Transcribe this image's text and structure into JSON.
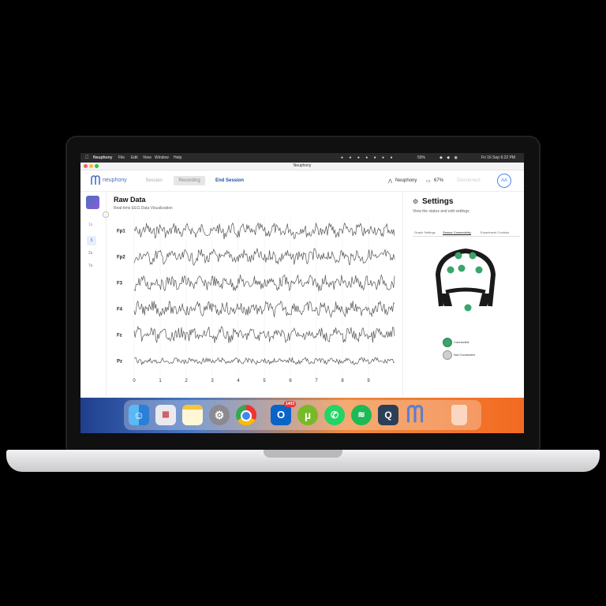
{
  "menubar": {
    "app": "Neuphony",
    "items": [
      "File",
      "Edit",
      "View",
      "Window",
      "Help"
    ],
    "battery": "59%",
    "datetime": "Fri 16 Sep 6:22 PM"
  },
  "window": {
    "title": "Neuphony"
  },
  "header": {
    "logo_text": "neuphony",
    "nav": [
      "Session",
      "Recording",
      "End Session"
    ],
    "device_name": "Neuphony",
    "battery": "67%",
    "status_btn": "Disconnect",
    "avatar": "AA"
  },
  "eeg": {
    "title": "Raw Data",
    "subtitle": "Real-time EEG Data Visualization",
    "channels": [
      "Fp1",
      "Fp2",
      "F3",
      "F4",
      "Fz",
      "Pz"
    ],
    "x_ticks": [
      "0",
      "1",
      "2",
      "3",
      "4",
      "5",
      "6",
      "7",
      "8",
      "9"
    ]
  },
  "tools": {
    "items": [
      "1s",
      "5",
      "2s",
      "7s"
    ]
  },
  "settings": {
    "title": "Settings",
    "subtitle": "View the status and edit settings",
    "tabs": [
      "Graph Settings",
      "Sensor Connectivity",
      "Experiment Controls"
    ],
    "legend": [
      {
        "label": "Connected",
        "color": "#3aa56b"
      },
      {
        "label": "Not Connected",
        "color": "#cfcfcf"
      }
    ]
  },
  "dock": {
    "badge": "1403",
    "apps": [
      "finder-icon",
      "launchpad-icon",
      "notes-icon",
      "settings-icon",
      "chrome-icon",
      "outlook-icon",
      "utorrent-icon",
      "whatsapp-icon",
      "spotify-icon",
      "quicktime-icon",
      "neuphony-icon",
      "trash-icon"
    ]
  },
  "colors": {
    "accent": "#1f4fa3",
    "connected": "#3aa56b"
  }
}
